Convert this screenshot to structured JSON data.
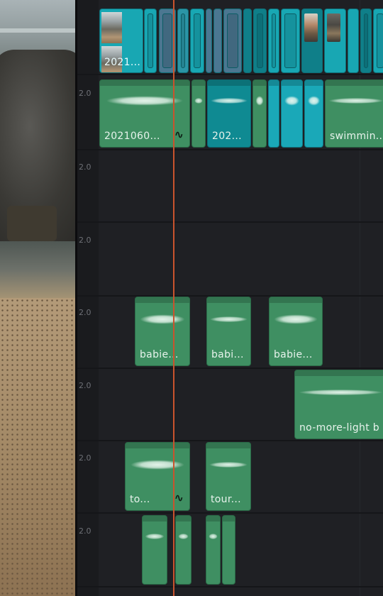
{
  "timeline": {
    "track_labels": [
      "2.0",
      "2.0",
      "2.0",
      "2.0",
      "2.0",
      "2.0",
      "2.0"
    ],
    "clips": [
      {
        "id": "v-2021",
        "label": "2021...",
        "track": "video"
      },
      {
        "id": "a1-2021060",
        "label": "2021060...",
        "track": "audio-1",
        "icon": "lfo-curve-icon"
      },
      {
        "id": "a1-202",
        "label": "202...",
        "track": "audio-1"
      },
      {
        "id": "a1-swimmin",
        "label": "swimmin...",
        "track": "audio-1"
      },
      {
        "id": "a3-babie-1",
        "label": "babie...",
        "track": "audio-3"
      },
      {
        "id": "a3-babi",
        "label": "babi...",
        "track": "audio-3"
      },
      {
        "id": "a3-babie-2",
        "label": "babie...",
        "track": "audio-3"
      },
      {
        "id": "a4-nomore",
        "label": "no-more-light b",
        "track": "audio-4"
      },
      {
        "id": "a5-to",
        "label": "to...",
        "track": "audio-5",
        "icon": "lfo-curve-icon"
      },
      {
        "id": "a5-tour",
        "label": "tour...",
        "track": "audio-5"
      }
    ],
    "colors": {
      "video_clip": "#18a7b3",
      "audio_clip": "#3f8f62",
      "playhead": "#c9532d",
      "background": "#1f2024"
    }
  }
}
